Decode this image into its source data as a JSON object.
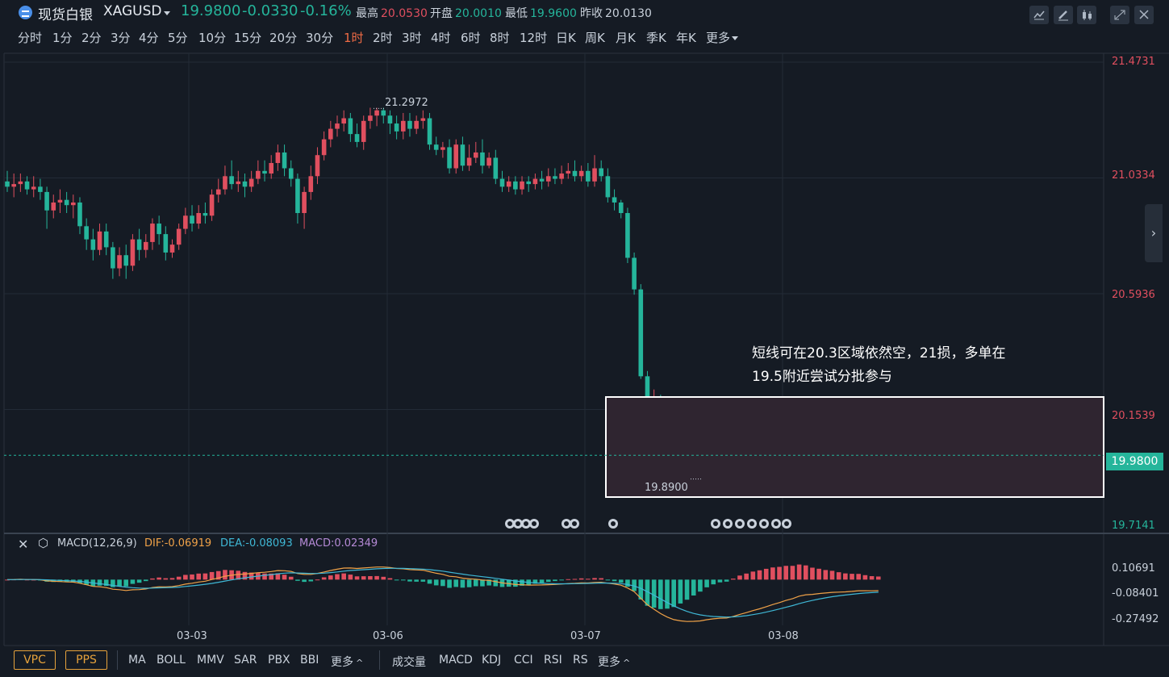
{
  "header": {
    "name": "现货白银",
    "code": "XAGUSD",
    "price": "19.9800",
    "change": "-0.0330",
    "change_pct": "-0.16%",
    "stats": [
      {
        "label": "最高",
        "value": "20.0530",
        "color": "#e04f5f"
      },
      {
        "label": "开盘",
        "value": "20.0010",
        "color": "#25b59b"
      },
      {
        "label": "最低",
        "value": "19.9600",
        "color": "#25b59b"
      },
      {
        "label": "昨收",
        "value": "20.0130",
        "color": "#c9d1db"
      }
    ],
    "tool_icons": [
      "line-chart-icon",
      "pen-icon",
      "candles-icon",
      "expand-icon",
      "close-icon"
    ]
  },
  "periods": [
    "分时",
    "1分",
    "2分",
    "3分",
    "4分",
    "5分",
    "10分",
    "15分",
    "20分",
    "30分",
    "1时",
    "2时",
    "3时",
    "4时",
    "6时",
    "8时",
    "12时",
    "日K",
    "周K",
    "月K",
    "季K",
    "年K",
    "更多"
  ],
  "active_period": "1时",
  "price_axis": {
    "ticks": [
      "21.4731",
      "21.0334",
      "20.5936",
      "20.1539",
      "19.7141"
    ],
    "current": "19.9800"
  },
  "markers": {
    "high": "21.2972",
    "low": "19.8900"
  },
  "annotation": {
    "line1": "短线可在20.3区域依然空，21损，多单在",
    "line2": "19.5附近尝试分批参与"
  },
  "macd": {
    "title": "MACD(12,26,9)",
    "dif": "DIF:-0.06919",
    "dea": "DEA:-0.08093",
    "macd": "MACD:0.02349",
    "ticks": [
      "0.10691",
      "-0.08401",
      "-0.27492"
    ]
  },
  "x_axis": [
    "03-03",
    "03-06",
    "03-07",
    "03-08"
  ],
  "bottom": {
    "pills": [
      "VPC",
      "PPS"
    ],
    "main_indicators": [
      "MA",
      "BOLL",
      "MMV",
      "SAR",
      "PBX",
      "BBI",
      "更多"
    ],
    "sub_indicators": [
      "成交量",
      "MACD",
      "KDJ",
      "CCI",
      "RSI",
      "RS",
      "更多"
    ]
  },
  "colors": {
    "up": "#e04f5f",
    "down": "#25b59b",
    "background": "#151b24",
    "dif": "#f0a248",
    "dea": "#3fb8d6",
    "macd_label": "#b58ad6"
  },
  "chart_data": {
    "type": "candlestick",
    "symbol": "XAGUSD",
    "interval": "1时",
    "y_range": [
      19.7141,
      21.4731
    ],
    "session_dates": [
      "03-03",
      "03-06",
      "03-07",
      "03-08"
    ],
    "candles": [
      [
        21.02,
        21.0,
        21.06,
        20.98
      ],
      [
        21.0,
        21.01,
        21.05,
        20.96
      ],
      [
        21.01,
        21.02,
        21.05,
        20.98
      ],
      [
        21.02,
        20.99,
        21.04,
        20.97
      ],
      [
        20.99,
        21.0,
        21.04,
        20.96
      ],
      [
        21.0,
        20.98,
        21.03,
        20.95
      ],
      [
        20.98,
        20.91,
        21.0,
        20.84
      ],
      [
        20.91,
        20.94,
        20.97,
        20.88
      ],
      [
        20.94,
        20.95,
        20.99,
        20.9
      ],
      [
        20.95,
        20.93,
        20.98,
        20.9
      ],
      [
        20.93,
        20.94,
        20.97,
        20.88
      ],
      [
        20.94,
        20.85,
        20.96,
        20.82
      ],
      [
        20.85,
        20.8,
        20.88,
        20.76
      ],
      [
        20.8,
        20.76,
        20.84,
        20.72
      ],
      [
        20.76,
        20.83,
        20.86,
        20.74
      ],
      [
        20.83,
        20.77,
        20.86,
        20.74
      ],
      [
        20.77,
        20.69,
        20.79,
        20.65
      ],
      [
        20.69,
        20.74,
        20.77,
        20.66
      ],
      [
        20.74,
        20.7,
        20.78,
        20.65
      ],
      [
        20.7,
        20.8,
        20.82,
        20.68
      ],
      [
        20.8,
        20.76,
        20.84,
        20.72
      ],
      [
        20.76,
        20.79,
        20.82,
        20.73
      ],
      [
        20.79,
        20.86,
        20.88,
        20.76
      ],
      [
        20.86,
        20.82,
        20.89,
        20.78
      ],
      [
        20.82,
        20.75,
        20.85,
        20.72
      ],
      [
        20.75,
        20.78,
        20.8,
        20.73
      ],
      [
        20.78,
        20.84,
        20.86,
        20.76
      ],
      [
        20.84,
        20.89,
        20.92,
        20.82
      ],
      [
        20.89,
        20.86,
        20.93,
        20.83
      ],
      [
        20.86,
        20.9,
        20.93,
        20.84
      ],
      [
        20.9,
        20.89,
        20.94,
        20.86
      ],
      [
        20.89,
        20.97,
        20.99,
        20.87
      ],
      [
        20.97,
        20.99,
        21.03,
        20.94
      ],
      [
        20.99,
        21.04,
        21.08,
        20.97
      ],
      [
        21.04,
        21.01,
        21.1,
        20.99
      ],
      [
        21.01,
        21.02,
        21.06,
        20.98
      ],
      [
        21.02,
        21.0,
        21.05,
        20.96
      ],
      [
        21.0,
        21.03,
        21.06,
        20.98
      ],
      [
        21.03,
        21.06,
        21.1,
        21.01
      ],
      [
        21.06,
        21.05,
        21.1,
        21.02
      ],
      [
        21.05,
        21.09,
        21.12,
        21.03
      ],
      [
        21.09,
        21.13,
        21.16,
        21.06
      ],
      [
        21.13,
        21.07,
        21.16,
        21.04
      ],
      [
        21.07,
        21.03,
        21.1,
        21.0
      ],
      [
        21.03,
        20.9,
        21.05,
        20.86
      ],
      [
        20.9,
        20.98,
        21.0,
        20.84
      ],
      [
        20.98,
        21.04,
        21.08,
        20.95
      ],
      [
        21.04,
        21.12,
        21.15,
        21.01
      ],
      [
        21.12,
        21.18,
        21.21,
        21.1
      ],
      [
        21.18,
        21.22,
        21.25,
        21.15
      ],
      [
        21.22,
        21.24,
        21.27,
        21.19
      ],
      [
        21.24,
        21.26,
        21.29,
        21.21
      ],
      [
        21.26,
        21.2,
        21.28,
        21.17
      ],
      [
        21.2,
        21.17,
        21.24,
        21.15
      ],
      [
        21.17,
        21.25,
        21.27,
        21.14
      ],
      [
        21.25,
        21.27,
        21.3,
        21.22
      ],
      [
        21.27,
        21.29,
        21.3,
        21.23
      ],
      [
        21.29,
        21.27,
        21.3,
        21.24
      ],
      [
        21.27,
        21.24,
        21.29,
        21.2
      ],
      [
        21.24,
        21.21,
        21.27,
        21.18
      ],
      [
        21.21,
        21.25,
        21.28,
        21.18
      ],
      [
        21.25,
        21.22,
        21.28,
        21.19
      ],
      [
        21.22,
        21.25,
        21.27,
        21.2
      ],
      [
        21.25,
        21.26,
        21.29,
        21.22
      ],
      [
        21.26,
        21.16,
        21.28,
        21.14
      ],
      [
        21.16,
        21.14,
        21.19,
        21.12
      ],
      [
        21.14,
        21.15,
        21.17,
        21.11
      ],
      [
        21.15,
        21.07,
        21.18,
        21.05
      ],
      [
        21.07,
        21.16,
        21.18,
        21.05
      ],
      [
        21.16,
        21.08,
        21.19,
        21.06
      ],
      [
        21.08,
        21.11,
        21.16,
        21.06
      ],
      [
        21.11,
        21.13,
        21.17,
        21.09
      ],
      [
        21.13,
        21.08,
        21.18,
        21.05
      ],
      [
        21.08,
        21.11,
        21.13,
        21.07
      ],
      [
        21.11,
        21.03,
        21.14,
        21.01
      ],
      [
        21.03,
        21.0,
        21.06,
        20.98
      ],
      [
        21.0,
        21.02,
        21.04,
        20.98
      ],
      [
        21.02,
        20.99,
        21.04,
        20.97
      ],
      [
        20.99,
        21.02,
        21.04,
        20.97
      ],
      [
        21.02,
        21.01,
        21.04,
        20.98
      ],
      [
        21.01,
        21.03,
        21.05,
        20.99
      ],
      [
        21.03,
        21.02,
        21.06,
        20.99
      ],
      [
        21.02,
        21.04,
        21.07,
        21.0
      ],
      [
        21.04,
        21.03,
        21.07,
        21.01
      ],
      [
        21.03,
        21.05,
        21.08,
        21.01
      ],
      [
        21.05,
        21.06,
        21.09,
        21.03
      ],
      [
        21.06,
        21.04,
        21.1,
        21.02
      ],
      [
        21.04,
        21.06,
        21.08,
        21.02
      ],
      [
        21.06,
        21.02,
        21.09,
        21.0
      ],
      [
        21.02,
        21.07,
        21.12,
        21.0
      ],
      [
        21.07,
        21.04,
        21.1,
        21.02
      ],
      [
        21.04,
        20.96,
        21.07,
        20.94
      ],
      [
        20.96,
        20.94,
        20.99,
        20.91
      ],
      [
        20.94,
        20.9,
        20.95,
        20.88
      ],
      [
        20.9,
        20.73,
        20.92,
        20.71
      ],
      [
        20.73,
        20.61,
        20.75,
        20.59
      ],
      [
        20.61,
        20.28,
        20.63,
        20.27
      ],
      [
        20.28,
        20.17,
        20.3,
        20.15
      ],
      [
        20.17,
        20.19,
        20.23,
        20.16
      ],
      [
        20.19,
        20.09,
        20.21,
        20.07
      ],
      [
        20.09,
        20.06,
        20.12,
        20.04
      ],
      [
        20.06,
        20.03,
        20.1,
        20.02
      ],
      [
        20.03,
        20.06,
        20.08,
        20.01
      ],
      [
        20.06,
        20.05,
        20.08,
        20.03
      ],
      [
        20.05,
        20.06,
        20.08,
        20.03
      ],
      [
        20.06,
        20.05,
        20.07,
        20.02
      ],
      [
        20.05,
        20.08,
        20.1,
        20.04
      ],
      [
        20.08,
        20.04,
        20.09,
        20.01
      ],
      [
        20.04,
        20.0,
        20.06,
        19.95
      ],
      [
        20.0,
        19.93,
        20.02,
        19.89
      ],
      [
        19.93,
        20.02,
        20.04,
        19.91
      ],
      [
        20.02,
        20.05,
        20.07,
        20.0
      ],
      [
        20.05,
        20.03,
        20.06,
        20.01
      ],
      [
        20.03,
        20.05,
        20.08,
        20.01
      ],
      [
        20.05,
        20.04,
        20.08,
        20.02
      ],
      [
        20.04,
        20.07,
        20.11,
        20.02
      ],
      [
        20.07,
        20.09,
        20.12,
        20.05
      ],
      [
        20.09,
        20.08,
        20.14,
        20.06
      ],
      [
        20.08,
        20.12,
        20.15,
        20.06
      ],
      [
        20.12,
        20.1,
        20.14,
        20.07
      ],
      [
        20.1,
        20.18,
        20.19,
        20.08
      ],
      [
        20.18,
        20.11,
        20.2,
        20.09
      ],
      [
        20.11,
        20.04,
        20.12,
        20.02
      ],
      [
        20.04,
        20.07,
        20.09,
        20.03
      ],
      [
        20.07,
        20.05,
        20.1,
        20.03
      ],
      [
        20.05,
        20.06,
        20.09,
        20.02
      ],
      [
        20.06,
        20.02,
        20.07,
        20.0
      ],
      [
        20.02,
        20.01,
        20.04,
        19.99
      ],
      [
        20.01,
        20.03,
        20.05,
        19.99
      ],
      [
        20.03,
        20.04,
        20.06,
        20.01
      ],
      [
        20.04,
        19.98,
        20.05,
        19.96
      ],
      [
        19.98,
        19.97,
        20.02,
        19.95
      ],
      [
        19.97,
        19.98,
        19.99,
        19.96
      ]
    ],
    "macd_series": {
      "dif_last": -0.06919,
      "dea_last": -0.08093,
      "macd_last": 0.02349,
      "y_range": [
        -0.3,
        0.15
      ]
    }
  }
}
